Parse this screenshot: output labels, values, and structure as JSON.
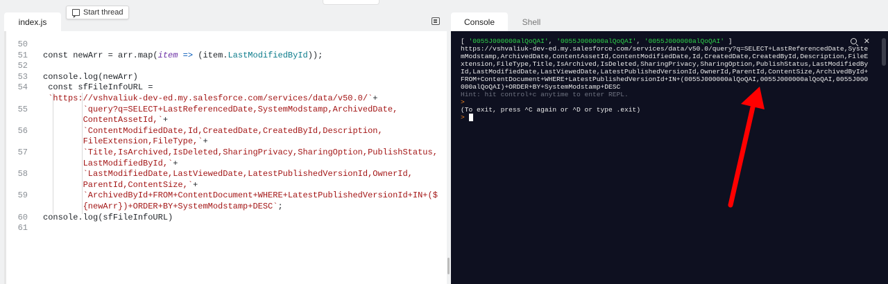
{
  "thread_button": {
    "label": "Start thread"
  },
  "editor": {
    "tab_label": "index.js",
    "lines": [
      {
        "num": "50",
        "html": ""
      },
      {
        "num": "51",
        "html": "<span class=\"kw\">const</span> newArr = arr.map(<span class=\"param\">item</span> <span class=\"arrow\">=&gt;</span> (item.<span class=\"prop\">LastModifiedById</span>));"
      },
      {
        "num": "52",
        "html": ""
      },
      {
        "num": "53",
        "html": "console.log(newArr)"
      },
      {
        "num": "54",
        "html": " <span class=\"kw\">const</span> sfFileInfoURL ="
      },
      {
        "num": "",
        "html": " <span class=\"str\">`https://vshvaliuk-dev-ed.my.salesforce.com/services/data/v50.0/`</span>+"
      },
      {
        "num": "55",
        "html": "        <span class=\"str\">`query?q=SELECT+LastReferencedDate,SystemModstamp,ArchivedDate,</span>"
      },
      {
        "num": "",
        "html": "        <span class=\"str\">ContentAssetId,`</span>+"
      },
      {
        "num": "56",
        "html": "        <span class=\"str\">`ContentModifiedDate,Id,CreatedDate,CreatedById,Description,</span>"
      },
      {
        "num": "",
        "html": "        <span class=\"str\">FileExtension,FileType,`</span>+"
      },
      {
        "num": "57",
        "html": "        <span class=\"str\">`Title,IsArchived,IsDeleted,SharingPrivacy,SharingOption,PublishStatus,</span>"
      },
      {
        "num": "",
        "html": "        <span class=\"str\">LastModifiedById,`</span>+"
      },
      {
        "num": "58",
        "html": "        <span class=\"str\">`LastModifiedDate,LastViewedDate,LatestPublishedVersionId,OwnerId,</span>"
      },
      {
        "num": "",
        "html": "        <span class=\"str\">ParentId,ContentSize,`</span>+"
      },
      {
        "num": "59",
        "html": "        <span class=\"str\">`ArchivedById+FROM+ContentDocument+WHERE+LatestPublishedVersionId+IN+($</span>"
      },
      {
        "num": "",
        "html": "        <span class=\"str\">{newArr})+ORDER+BY+SystemModstamp+DESC`</span>;"
      },
      {
        "num": "60",
        "html": "console.log(sfFileInfoURL)"
      },
      {
        "num": "61",
        "html": ""
      }
    ]
  },
  "console_panel": {
    "tabs": [
      "Console",
      "Shell"
    ],
    "output_lines": [
      "[ <span class=\"green\">'0055J000000alQoQAI'</span>, <span class=\"green\">'0055J000000alQoQAI'</span>, <span class=\"green\">'0055J000000alQoQAI'</span> ]",
      "https://vshvaliuk-dev-ed.my.salesforce.com/services/data/v50.0/query?q=SELECT+LastReferencedDate,Syste",
      "mModstamp,ArchivedDate,ContentAssetId,ContentModifiedDate,Id,CreatedDate,CreatedById,Description,FileE",
      "xtension,FileType,Title,IsArchived,IsDeleted,SharingPrivacy,SharingOption,PublishStatus,LastModifiedBy",
      "Id,LastModifiedDate,LastViewedDate,LatestPublishedVersionId,OwnerId,ParentId,ContentSize,ArchivedById+",
      "FROM+ContentDocument+WHERE+LatestPublishedVersionId+IN+(0055J000000alQoQAI,0055J000000alQoQAI,0055J000",
      "000alQoQAI)+ORDER+BY+SystemModstamp+DESC",
      "<span class=\"dim\">Hint: hit control+c anytime to enter REPL.</span>",
      "<span class=\"orange\">&gt;</span>",
      "(To exit, press ^C again or ^D or type .exit)",
      "<span class=\"orange\">&gt;</span> <span class=\"cursor\"></span>"
    ]
  },
  "colors": {
    "arrow_annotation": "#ff0000",
    "console_bg": "#0e1020"
  }
}
